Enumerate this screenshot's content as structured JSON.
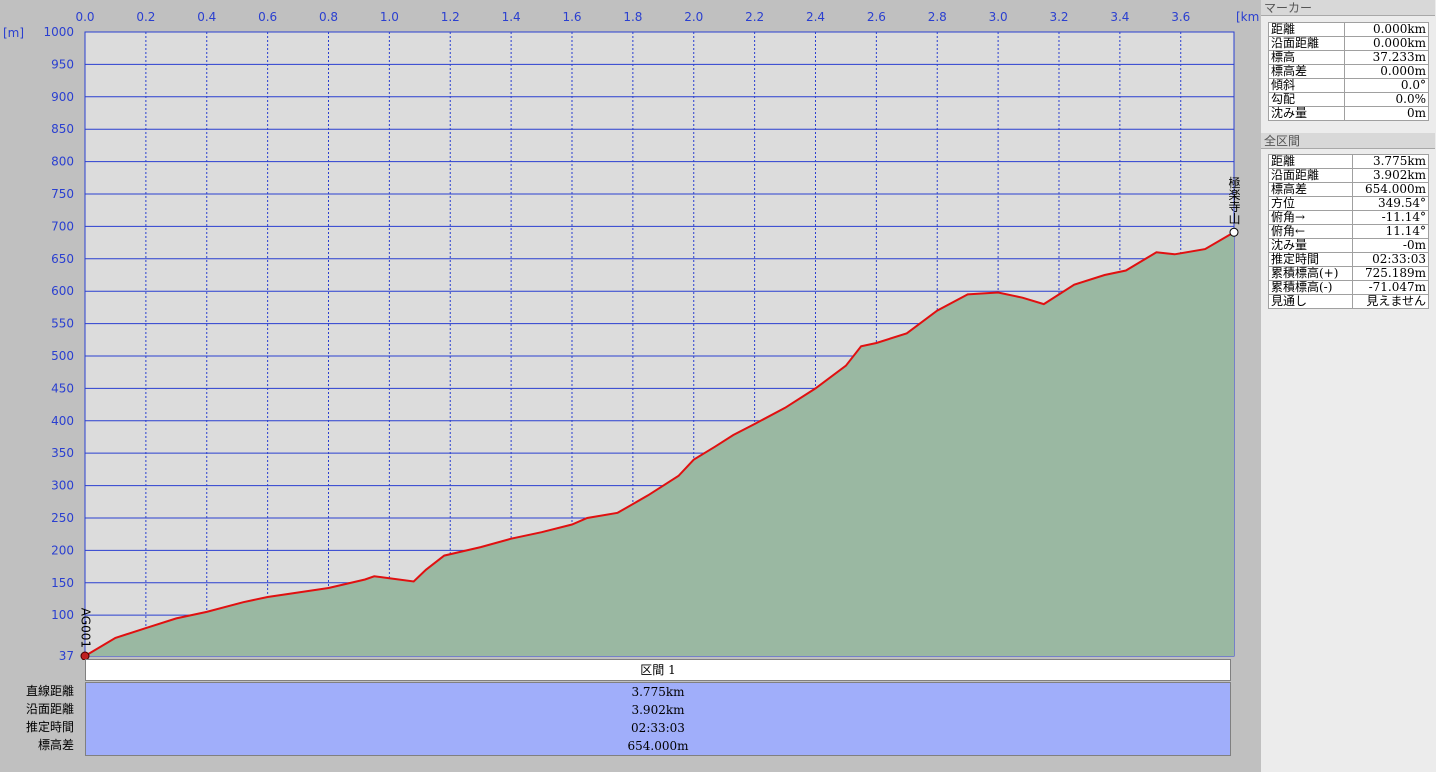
{
  "chart_data": {
    "type": "area",
    "x_unit": "[km]",
    "y_unit": "[m]",
    "xlim": [
      0,
      3.775
    ],
    "ylim": [
      37,
      1000
    ],
    "x_ticks": [
      "0.0",
      "0.2",
      "0.4",
      "0.6",
      "0.8",
      "1.0",
      "1.2",
      "1.4",
      "1.6",
      "1.8",
      "2.0",
      "2.2",
      "2.4",
      "2.6",
      "2.8",
      "3.0",
      "3.2",
      "3.4",
      "3.6"
    ],
    "y_ticks": [
      "1000",
      "950",
      "900",
      "850",
      "800",
      "750",
      "700",
      "650",
      "600",
      "550",
      "500",
      "450",
      "400",
      "350",
      "300",
      "250",
      "200",
      "150",
      "100"
    ],
    "y_start_label": "37",
    "series": [
      {
        "x": [
          0.0,
          0.1,
          0.2,
          0.3,
          0.4,
          0.52,
          0.6,
          0.7,
          0.8,
          0.92,
          0.95,
          1.0,
          1.08,
          1.12,
          1.18,
          1.3,
          1.4,
          1.5,
          1.6,
          1.65,
          1.75,
          1.85,
          1.95,
          2.0,
          2.07,
          2.13,
          2.2,
          2.3,
          2.4,
          2.5,
          2.55,
          2.6,
          2.7,
          2.8,
          2.9,
          3.0,
          3.08,
          3.15,
          3.25,
          3.35,
          3.42,
          3.52,
          3.58,
          3.68,
          3.775
        ],
        "y": [
          37,
          65,
          80,
          95,
          105,
          120,
          128,
          135,
          142,
          155,
          160,
          157,
          152,
          170,
          192,
          205,
          218,
          228,
          240,
          250,
          258,
          285,
          315,
          340,
          360,
          378,
          395,
          420,
          450,
          485,
          515,
          520,
          535,
          570,
          595,
          598,
          590,
          580,
          610,
          625,
          632,
          660,
          657,
          665,
          691
        ]
      }
    ],
    "grid": true,
    "start_marker": "AG001",
    "end_marker": "極楽寺山"
  },
  "section": {
    "title": "区間 1",
    "rows": [
      {
        "label": "直線距離",
        "value": "3.775km"
      },
      {
        "label": "沿面距離",
        "value": "3.902km"
      },
      {
        "label": "推定時間",
        "value": "02:33:03"
      },
      {
        "label": "標高差",
        "value": "654.000m"
      }
    ]
  },
  "marker_panel": {
    "title": "マーカー",
    "rows": [
      {
        "label": "距離",
        "value": "0.000km"
      },
      {
        "label": "沿面距離",
        "value": "0.000km"
      },
      {
        "label": "標高",
        "value": "37.233m"
      },
      {
        "label": "標高差",
        "value": "0.000m"
      },
      {
        "label": "傾斜",
        "value": "0.0°"
      },
      {
        "label": "勾配",
        "value": "0.0%"
      },
      {
        "label": "沈み量",
        "value": "0m"
      }
    ]
  },
  "total_panel": {
    "title": "全区間",
    "rows": [
      {
        "label": "距離",
        "value": "3.775km"
      },
      {
        "label": "沿面距離",
        "value": "3.902km"
      },
      {
        "label": "標高差",
        "value": "654.000m"
      },
      {
        "label": "方位",
        "value": "349.54°"
      },
      {
        "label": "俯角→",
        "value": "-11.14°"
      },
      {
        "label": "俯角←",
        "value": "11.14°"
      },
      {
        "label": "沈み量",
        "value": "-0m"
      },
      {
        "label": "推定時間",
        "value": "02:33:03"
      },
      {
        "label": "累積標高(+)",
        "value": "725.189m"
      },
      {
        "label": "累積標高(-)",
        "value": "-71.047m"
      },
      {
        "label": "見通し",
        "value": "見えません"
      }
    ]
  },
  "colors": {
    "plot_bg": "#dcdcdc",
    "grid": "#2a3fd0",
    "fill": "#9ab8a2",
    "line": "#e01010",
    "section_body": "#a0aefa"
  }
}
